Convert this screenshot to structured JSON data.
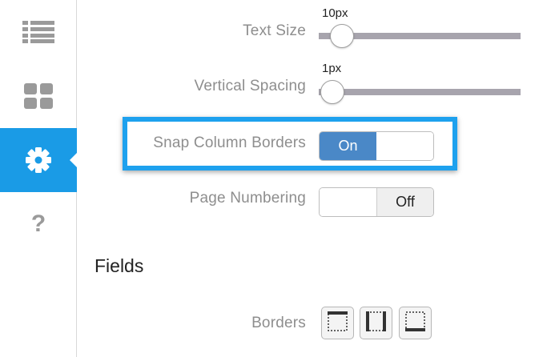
{
  "sidebar": {
    "items": [
      {
        "icon": "list-icon",
        "active": false
      },
      {
        "icon": "grid-icon",
        "active": false
      },
      {
        "icon": "gear-icon",
        "active": true
      },
      {
        "icon": "help-icon",
        "glyph": "?",
        "active": false
      }
    ]
  },
  "settings": {
    "text_size": {
      "label": "Text Size",
      "value": "10px"
    },
    "vertical_spacing": {
      "label": "Vertical Spacing",
      "value": "1px"
    },
    "snap_column_borders": {
      "label": "Snap Column Borders",
      "state": "On",
      "on_label": "On"
    },
    "page_numbering": {
      "label": "Page Numbering",
      "state": "Off",
      "off_label": "Off"
    }
  },
  "fields": {
    "title": "Fields",
    "borders_label": "Borders",
    "border_buttons": [
      "border-top-icon",
      "border-sides-icon",
      "border-bottom-icon"
    ]
  },
  "colors": {
    "accent": "#1a9be6",
    "toggle_on": "#4a88c7",
    "highlight": "#1ea1ee"
  }
}
